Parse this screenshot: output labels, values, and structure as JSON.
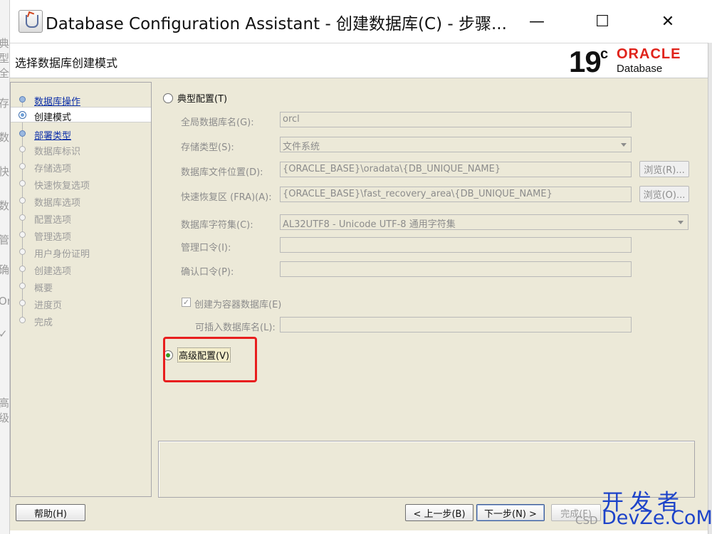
{
  "window": {
    "title": "Database Configuration Assistant - 创建数据库(C) - 步骤...",
    "minimize_glyph": "—",
    "maximize_glyph": "☐",
    "close_glyph": "✕"
  },
  "header": {
    "title": "选择数据库创建模式",
    "logo_version": "19",
    "logo_version_sup": "c",
    "logo_brand": "ORACLE",
    "logo_product": "Database"
  },
  "steps": [
    {
      "label": "数据库操作",
      "state": "done"
    },
    {
      "label": "创建模式",
      "state": "active"
    },
    {
      "label": "部署类型",
      "state": "done"
    },
    {
      "label": "数据库标识",
      "state": "todo"
    },
    {
      "label": "存储选项",
      "state": "todo"
    },
    {
      "label": "快速恢复选项",
      "state": "todo"
    },
    {
      "label": "数据库选项",
      "state": "todo"
    },
    {
      "label": "配置选项",
      "state": "todo"
    },
    {
      "label": "管理选项",
      "state": "todo"
    },
    {
      "label": "用户身份证明",
      "state": "todo"
    },
    {
      "label": "创建选项",
      "state": "todo"
    },
    {
      "label": "概要",
      "state": "todo"
    },
    {
      "label": "进度页",
      "state": "todo"
    },
    {
      "label": "完成",
      "state": "todo"
    }
  ],
  "typical": {
    "radio_label": "典型配置(T)",
    "selected": false,
    "fields": {
      "global_db_name": {
        "label": "全局数据库名(G):",
        "value": "orcl"
      },
      "storage_type": {
        "label": "存储类型(S):",
        "value": "文件系统"
      },
      "db_file_location": {
        "label": "数据库文件位置(D):",
        "value": "{ORACLE_BASE}\\oradata\\{DB_UNIQUE_NAME}",
        "browse": "浏览(R)..."
      },
      "fra": {
        "label": "快速恢复区 (FRA)(A):",
        "value": "{ORACLE_BASE}\\fast_recovery_area\\{DB_UNIQUE_NAME}",
        "browse": "浏览(O)..."
      },
      "charset": {
        "label": "数据库字符集(C):",
        "value": "AL32UTF8 - Unicode UTF-8 通用字符集"
      },
      "admin_password": {
        "label": "管理口令(I):",
        "value": ""
      },
      "confirm_password": {
        "label": "确认口令(P):",
        "value": ""
      },
      "container_db": {
        "label": "创建为容器数据库(E)",
        "checked": true,
        "check_glyph": "✓"
      },
      "pdb_name": {
        "label": "可插入数据库名(L):",
        "value": ""
      }
    }
  },
  "advanced": {
    "radio_label": "高级配置(V)",
    "selected": true
  },
  "footer": {
    "help": "帮助(H)",
    "back": "< 上一步(B)",
    "next": "下一步(N) >",
    "finish": "完成(F)"
  },
  "background_window_chars": [
    "典型",
    "全",
    "存",
    "数",
    "快",
    "数",
    "管",
    "确",
    "Or",
    "✓",
    "高级"
  ],
  "watermark": {
    "mark": "开发者",
    "text": "DevZe.CoM",
    "csd": "CSD"
  },
  "colors": {
    "highlight": "#e81e1e",
    "oracle_red": "#e0231b",
    "link_blue": "#0b2ea8",
    "radio_green": "#3a9a26",
    "watermark_blue": "#1d43c9"
  }
}
